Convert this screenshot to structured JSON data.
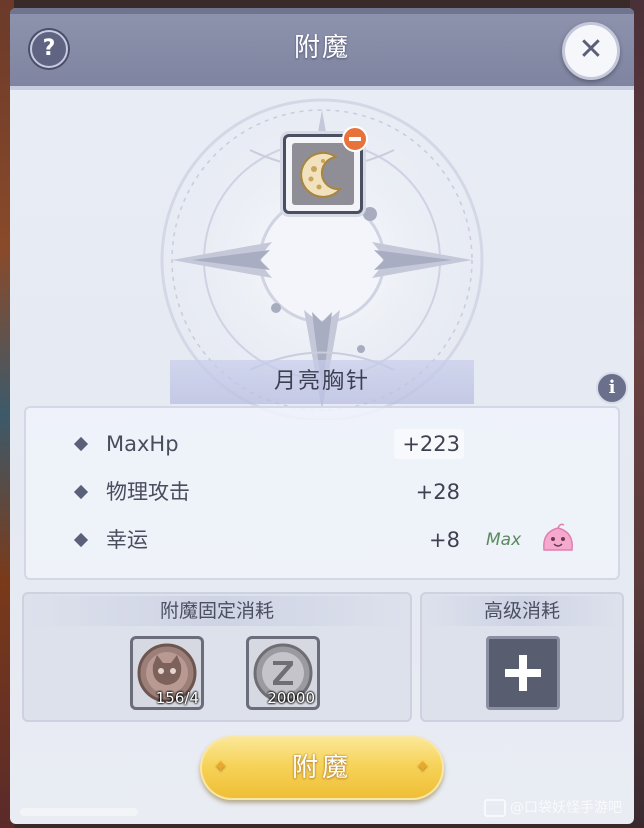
{
  "window": {
    "title": "附魔",
    "help_icon": "question-mark-icon",
    "help_glyph": "?",
    "close_icon": "close-icon",
    "close_glyph": "✕"
  },
  "item": {
    "name": "月亮胸针",
    "icon": "crescent-moon-brooch-icon",
    "remove_icon": "minus-badge-icon",
    "info_glyph": "i"
  },
  "stats": [
    {
      "label": "MaxHp",
      "value": "+223"
    },
    {
      "label": "物理攻击",
      "value": "+28"
    },
    {
      "label": "幸运",
      "value": "+8",
      "tag": "Max",
      "tag_icon": "pink-poring-icon"
    }
  ],
  "fixed_cost": {
    "title": "附魔固定消耗",
    "materials": [
      {
        "icon": "cat-coin-icon",
        "count": "156/4"
      },
      {
        "icon": "zeny-coin-icon",
        "count": "20000"
      }
    ]
  },
  "advanced_cost": {
    "title": "高级消耗",
    "add_icon": "plus-icon"
  },
  "action": {
    "enchant_label": "附魔"
  },
  "watermark": {
    "text": "@口袋妖怪手游吧"
  },
  "colors": {
    "header": "#8e93ae",
    "panel": "#e9edf5",
    "button_gold": "#f6d35a",
    "max_green": "#5a8a5e",
    "badge_orange": "#e8723c"
  }
}
